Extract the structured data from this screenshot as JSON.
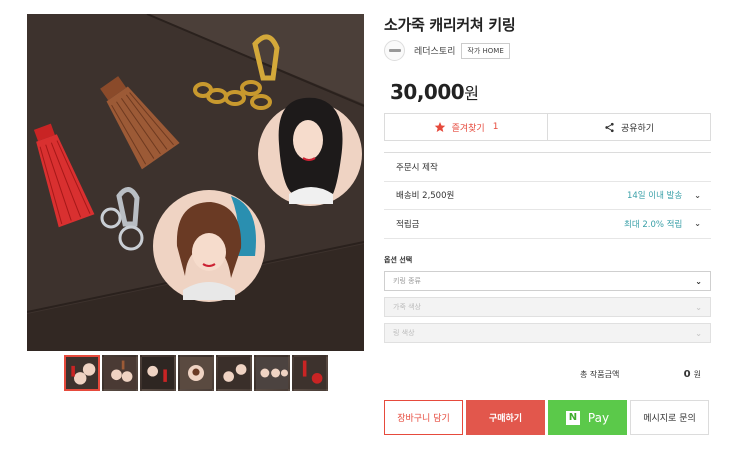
{
  "product": {
    "title": "소가죽 캐리커쳐 키링",
    "seller_name": "레더스토리",
    "seller_home_label": "작가 HOME",
    "price": "30,000",
    "price_unit": "원"
  },
  "actions": {
    "favorite_label": "즐겨찾기",
    "favorite_count": "1",
    "share_label": "공유하기"
  },
  "info": {
    "made_to_order": "주문시 제작",
    "shipping_label": "배송비 2,500원",
    "shipping_value": "14일 이내 발송",
    "points_label": "적립금",
    "points_value": "최대 2.0% 적립"
  },
  "options": {
    "section_label": "옵션 선택",
    "select_1": "키링 종류",
    "select_2": "가죽 색상",
    "select_3": "링 색상"
  },
  "total": {
    "label": "총 작품금액",
    "value": "0",
    "unit": "원"
  },
  "buttons": {
    "cart": "장바구니 담기",
    "buy": "구매하기",
    "npay_badge": "N",
    "npay": "Pay",
    "message": "메시지로 문의"
  },
  "thumbnails": [
    {
      "label": ""
    },
    {
      "label": ""
    },
    {
      "label": ""
    },
    {
      "label": ""
    },
    {
      "label": ""
    },
    {
      "label": ""
    },
    {
      "label": ""
    }
  ],
  "colors": {
    "accent_red": "#e64a3c",
    "teal": "#3aa0a8",
    "npay_green": "#5bc94a"
  },
  "icons": [
    "star-icon",
    "share-icon",
    "chevron-down-icon",
    "caret-down-icon",
    "npay-logo"
  ]
}
